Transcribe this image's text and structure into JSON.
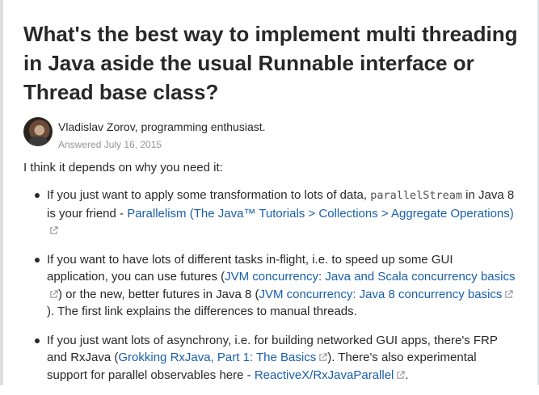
{
  "question": {
    "title": "What's the best way to implement multi threading in Java aside the usual Runnable interface or Thread base class?"
  },
  "author": {
    "name": "Vladislav Zorov, programming enthusiast.",
    "meta": "Answered July 16, 2015"
  },
  "answer": {
    "intro": "I think it depends on why you need it:",
    "items": [
      {
        "t1": "If you just want to apply some transformation to lots of data, ",
        "code": "parallelStream",
        "t2": " in Java 8 is your friend - ",
        "link1": "Parallelism (The Java™ Tutorials > Collections > Aggregate Operations)"
      },
      {
        "t1": "If you want to have lots of different tasks in-flight, i.e. to speed up some GUI application, you can use futures (",
        "link1": "JVM concurrency: Java and Scala concurrency basics",
        "t2": ") or the new, better futures in Java 8 (",
        "link2": "JVM concurrency: Java 8 concurrency basics",
        "t3": "). The first link explains the differences to manual threads."
      },
      {
        "t1": "If you just want lots of asynchrony, i.e. for building networked GUI apps, there's FRP and RxJava (",
        "link1": "Grokking RxJava, Part 1: The Basics",
        "t2": "). There's also experimental support for parallel observables here - ",
        "link2": "ReactiveX/RxJavaParallel",
        "t3": "."
      }
    ]
  },
  "colors": {
    "link": "#195faa",
    "text": "#282829",
    "muted": "#939598"
  },
  "icons": {
    "external_link": "external-link-icon",
    "bullet": "bullet-dot"
  }
}
